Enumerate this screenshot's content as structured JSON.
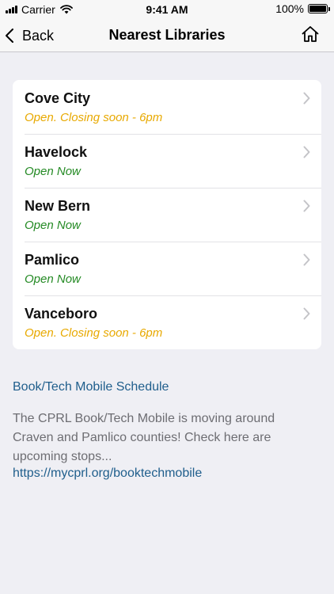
{
  "status_bar": {
    "carrier": "Carrier",
    "time": "9:41 AM",
    "battery": "100%"
  },
  "nav": {
    "back_label": "Back",
    "title": "Nearest Libraries"
  },
  "libraries": [
    {
      "name": "Cove City",
      "status": "Open. Closing soon - 6pm",
      "status_color": "#e8a900"
    },
    {
      "name": "Havelock",
      "status": "Open Now",
      "status_color": "#248a24"
    },
    {
      "name": "New Bern",
      "status": "Open Now",
      "status_color": "#248a24"
    },
    {
      "name": "Pamlico",
      "status": "Open Now",
      "status_color": "#248a24"
    },
    {
      "name": "Vanceboro",
      "status": "Open. Closing soon - 6pm",
      "status_color": "#e8a900"
    }
  ],
  "schedule": {
    "link_label": "Book/Tech Mobile Schedule",
    "description": "The CPRL Book/Tech Mobile is moving around Craven and Pamlico counties! Check here are upcoming stops...",
    "url_text": "https://mycprl.org/booktechmobile"
  }
}
